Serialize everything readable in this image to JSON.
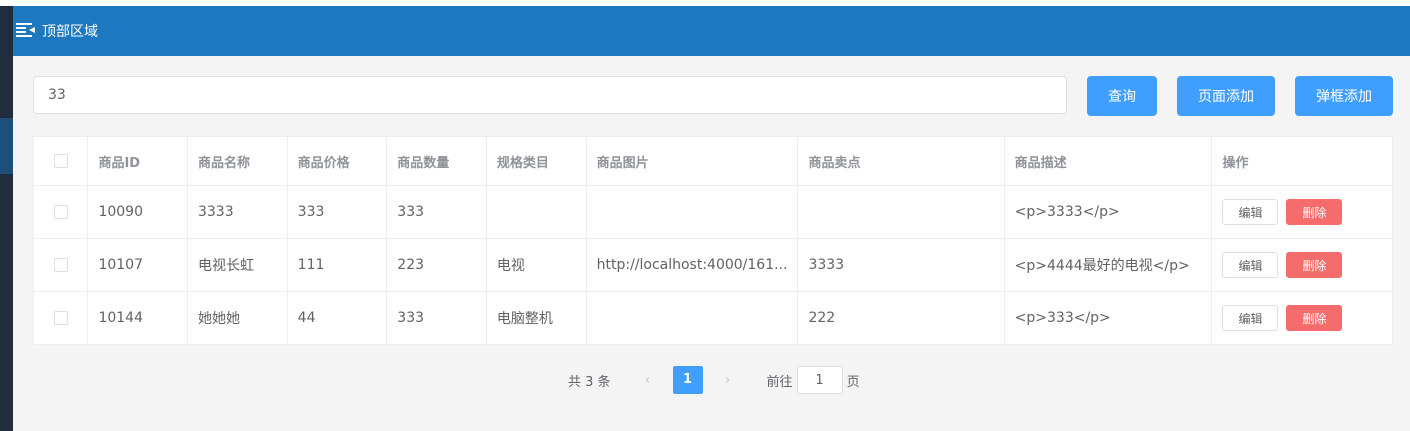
{
  "header": {
    "title": "顶部区域",
    "menu_icon": "menu-fold-icon",
    "bg_color": "#1e78c0"
  },
  "search": {
    "value": "33",
    "placeholder": ""
  },
  "buttons": {
    "query": "查询",
    "page_add": "页面添加",
    "dialog_add": "弹框添加"
  },
  "table": {
    "columns": [
      "商品ID",
      "商品名称",
      "商品价格",
      "商品数量",
      "规格类目",
      "商品图片",
      "商品卖点",
      "商品描述",
      "操作"
    ],
    "rows": [
      {
        "id": "10090",
        "name": "3333",
        "price": "333",
        "num": "333",
        "category": "",
        "image": "",
        "sell_point": "",
        "desc": "<p>3333</p>"
      },
      {
        "id": "10107",
        "name": "电视长虹",
        "price": "111",
        "num": "223",
        "category": "电视",
        "image": "http://localhost:4000/161...",
        "sell_point": "3333",
        "desc": "<p>4444最好的电视</p>"
      },
      {
        "id": "10144",
        "name": "她她她",
        "price": "44",
        "num": "333",
        "category": "电脑整机",
        "image": "",
        "sell_point": "222",
        "desc": "<p>333</p>"
      }
    ],
    "edit_label": "编辑",
    "delete_label": "删除"
  },
  "pagination": {
    "total_text": "共 3 条",
    "current_page": "1",
    "goto_prefix": "前往",
    "goto_value": "1",
    "goto_suffix": "页"
  },
  "colors": {
    "primary": "#409eff",
    "danger": "#f56c6c"
  }
}
